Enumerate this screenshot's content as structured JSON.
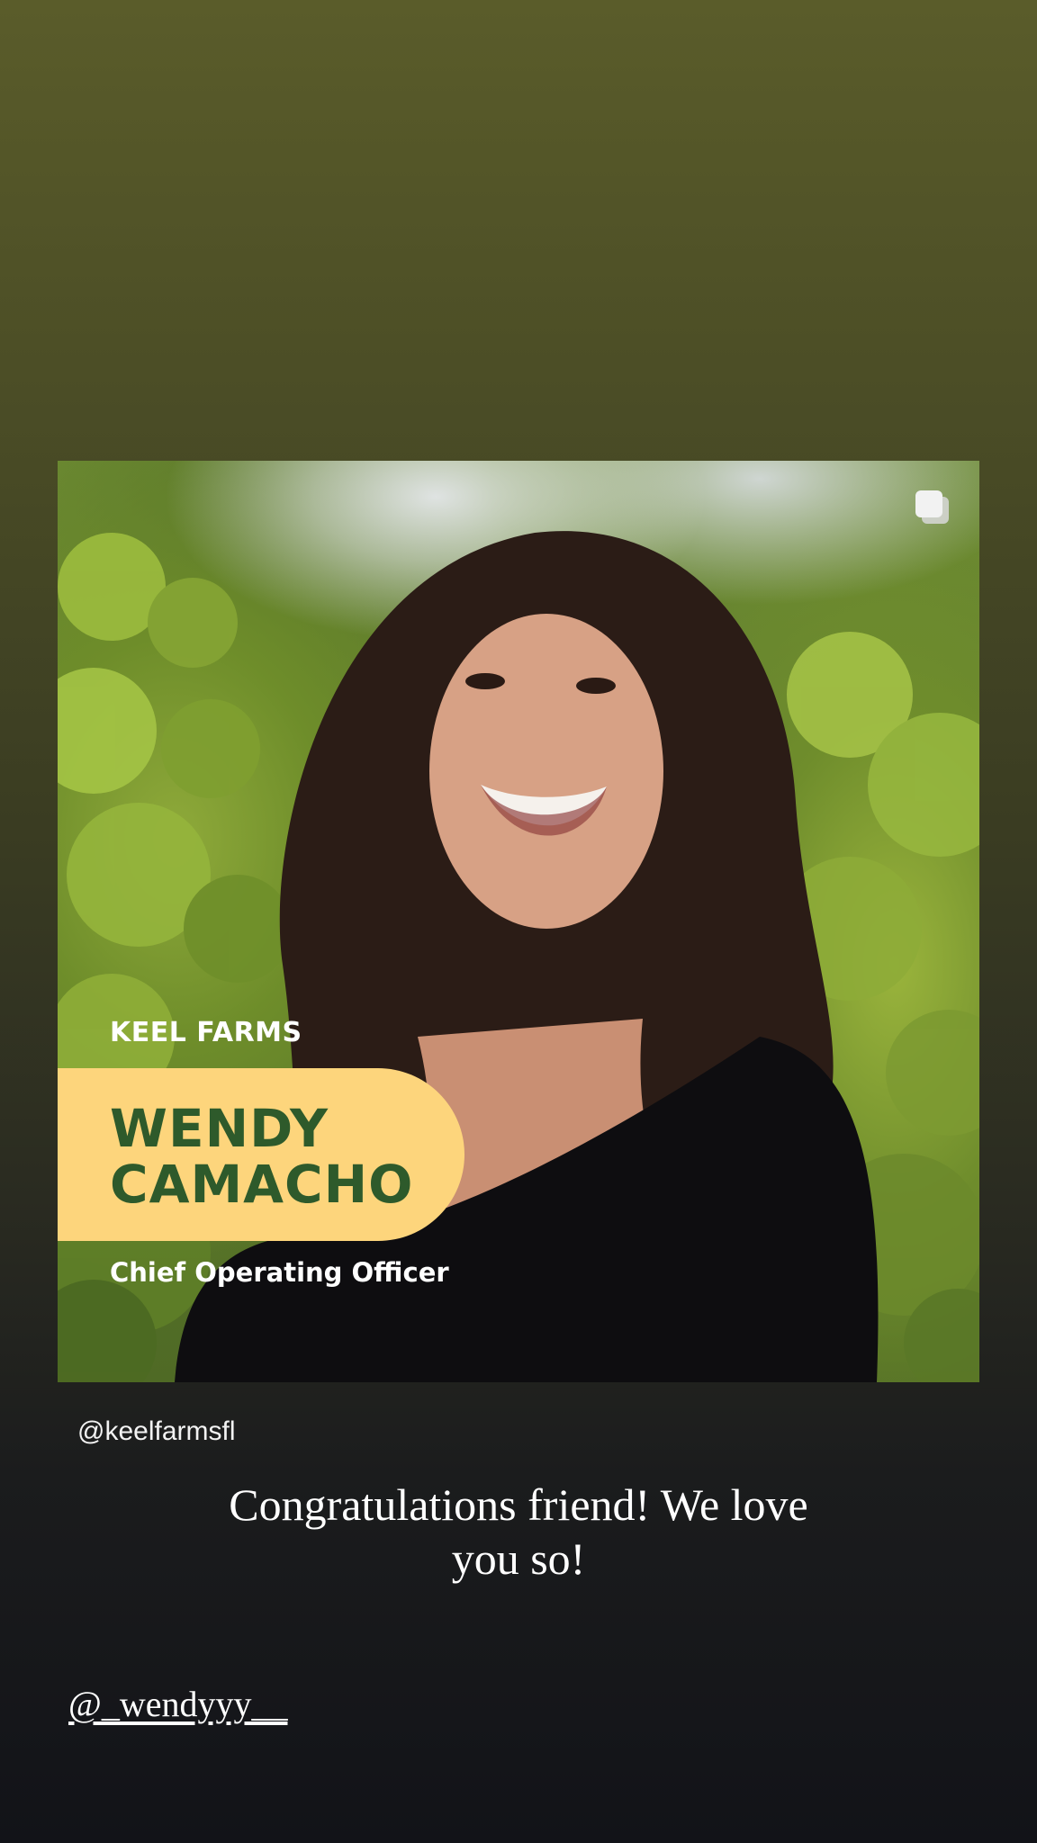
{
  "post": {
    "brand": "KEEL FARMS",
    "name_line1": "WENDY",
    "name_line2": "CAMACHO",
    "role": "Chief Operating Officer",
    "author_handle": "@keelfarmsfl",
    "icon": "multiple-images-icon"
  },
  "story": {
    "caption": "Congratulations friend! We love you so!",
    "mention": "@_wendyyy__"
  },
  "colors": {
    "pill": "#fdd57c",
    "name_text": "#2e5a2b",
    "background_top": "#5a5c2a",
    "background_bottom": "#121318"
  }
}
